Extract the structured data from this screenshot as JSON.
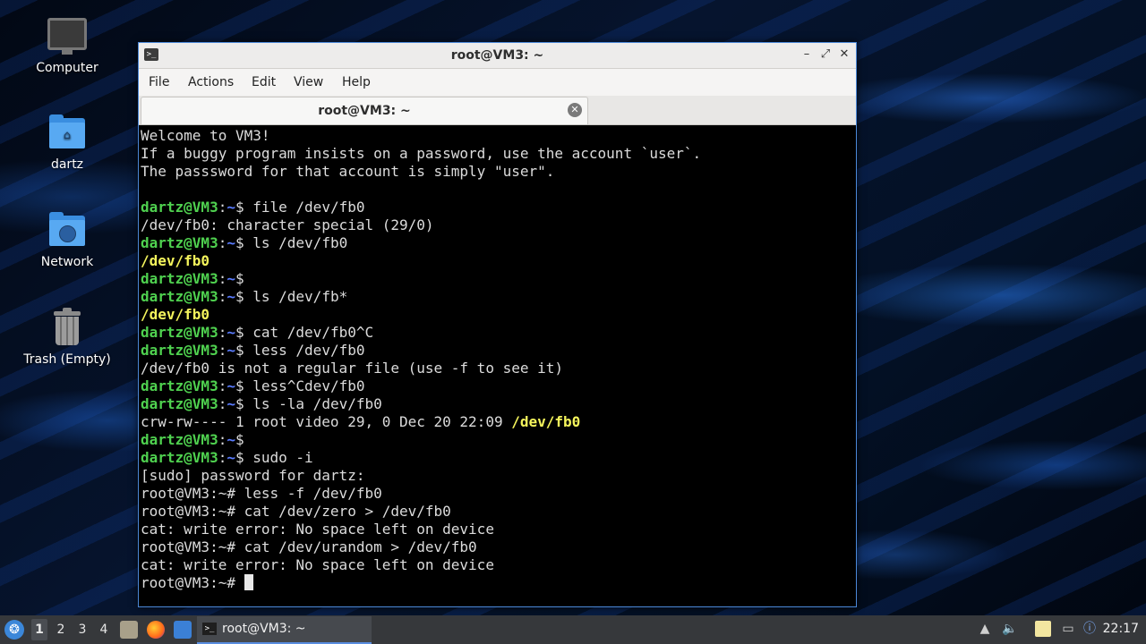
{
  "desktop": {
    "icons": [
      {
        "label": "Computer",
        "icon": "computer-icon"
      },
      {
        "label": "dartz",
        "icon": "home-folder-icon"
      },
      {
        "label": "Network",
        "icon": "network-folder-icon"
      },
      {
        "label": "Trash (Empty)",
        "icon": "trash-icon"
      }
    ]
  },
  "window": {
    "title": "root@VM3: ~",
    "menu": [
      "File",
      "Actions",
      "Edit",
      "View",
      "Help"
    ],
    "tab_label": "root@VM3: ~",
    "controls": {
      "minimize": "–",
      "maximize": "⤢",
      "close": "✕"
    }
  },
  "terminal": {
    "lines": [
      [
        {
          "t": "Welcome to VM3!",
          "c": "text"
        }
      ],
      [
        {
          "t": "If a buggy program insists on a password, use the account `user`.",
          "c": "text"
        }
      ],
      [
        {
          "t": "The passsword for that account is simply \"user\".",
          "c": "text"
        }
      ],
      [
        {
          "t": "",
          "c": "text"
        }
      ],
      [
        {
          "t": "dartz@VM3",
          "c": "user"
        },
        {
          "t": ":",
          "c": "text"
        },
        {
          "t": "~",
          "c": "path"
        },
        {
          "t": "$ file /dev/fb0",
          "c": "text"
        }
      ],
      [
        {
          "t": "/dev/fb0: character special (29/0)",
          "c": "text"
        }
      ],
      [
        {
          "t": "dartz@VM3",
          "c": "user"
        },
        {
          "t": ":",
          "c": "text"
        },
        {
          "t": "~",
          "c": "path"
        },
        {
          "t": "$ ls /dev/fb0",
          "c": "text"
        }
      ],
      [
        {
          "t": "/dev/fb0",
          "c": "hl"
        }
      ],
      [
        {
          "t": "dartz@VM3",
          "c": "user"
        },
        {
          "t": ":",
          "c": "text"
        },
        {
          "t": "~",
          "c": "path"
        },
        {
          "t": "$",
          "c": "text"
        }
      ],
      [
        {
          "t": "dartz@VM3",
          "c": "user"
        },
        {
          "t": ":",
          "c": "text"
        },
        {
          "t": "~",
          "c": "path"
        },
        {
          "t": "$ ls /dev/fb*",
          "c": "text"
        }
      ],
      [
        {
          "t": "/dev/fb0",
          "c": "hl"
        }
      ],
      [
        {
          "t": "dartz@VM3",
          "c": "user"
        },
        {
          "t": ":",
          "c": "text"
        },
        {
          "t": "~",
          "c": "path"
        },
        {
          "t": "$ cat /dev/fb0^C",
          "c": "text"
        }
      ],
      [
        {
          "t": "dartz@VM3",
          "c": "user"
        },
        {
          "t": ":",
          "c": "text"
        },
        {
          "t": "~",
          "c": "path"
        },
        {
          "t": "$ less /dev/fb0",
          "c": "text"
        }
      ],
      [
        {
          "t": "/dev/fb0 is not a regular file (use -f to see it)",
          "c": "text"
        }
      ],
      [
        {
          "t": "dartz@VM3",
          "c": "user"
        },
        {
          "t": ":",
          "c": "text"
        },
        {
          "t": "~",
          "c": "path"
        },
        {
          "t": "$ less^Cdev/fb0",
          "c": "text"
        }
      ],
      [
        {
          "t": "dartz@VM3",
          "c": "user"
        },
        {
          "t": ":",
          "c": "text"
        },
        {
          "t": "~",
          "c": "path"
        },
        {
          "t": "$ ls -la /dev/fb0",
          "c": "text"
        }
      ],
      [
        {
          "t": "crw-rw---- 1 root video 29, 0 Dec 20 22:09 ",
          "c": "text"
        },
        {
          "t": "/dev/fb0",
          "c": "hl"
        }
      ],
      [
        {
          "t": "dartz@VM3",
          "c": "user"
        },
        {
          "t": ":",
          "c": "text"
        },
        {
          "t": "~",
          "c": "path"
        },
        {
          "t": "$",
          "c": "text"
        }
      ],
      [
        {
          "t": "dartz@VM3",
          "c": "user"
        },
        {
          "t": ":",
          "c": "text"
        },
        {
          "t": "~",
          "c": "path"
        },
        {
          "t": "$ sudo -i",
          "c": "text"
        }
      ],
      [
        {
          "t": "[sudo] password for dartz:",
          "c": "text"
        }
      ],
      [
        {
          "t": "root@VM3:~# less -f /dev/fb0",
          "c": "text"
        }
      ],
      [
        {
          "t": "root@VM3:~# cat /dev/zero > /dev/fb0",
          "c": "text"
        }
      ],
      [
        {
          "t": "cat: write error: No space left on device",
          "c": "text"
        }
      ],
      [
        {
          "t": "root@VM3:~# cat /dev/urandom > /dev/fb0",
          "c": "text"
        }
      ],
      [
        {
          "t": "cat: write error: No space left on device",
          "c": "text"
        }
      ],
      [
        {
          "t": "root@VM3:~# ",
          "c": "text"
        },
        {
          "t": "",
          "c": "cursor"
        }
      ]
    ]
  },
  "taskbar": {
    "workspaces": [
      "1",
      "2",
      "3",
      "4"
    ],
    "active_workspace": "1",
    "launchers": [
      "files-icon",
      "firefox-icon",
      "desktop-icon"
    ],
    "task": {
      "label": "root@VM3: ~",
      "icon": "terminal-icon"
    },
    "tray": [
      "bell-icon",
      "volume-icon",
      "clipboard-icon",
      "network-icon",
      "updates-icon"
    ],
    "clock": "22:17"
  },
  "colors": {
    "prompt_user": "#4fd14f",
    "prompt_path": "#5a7cff",
    "highlight": "#f4f45c",
    "window_border": "#4b88d8"
  }
}
